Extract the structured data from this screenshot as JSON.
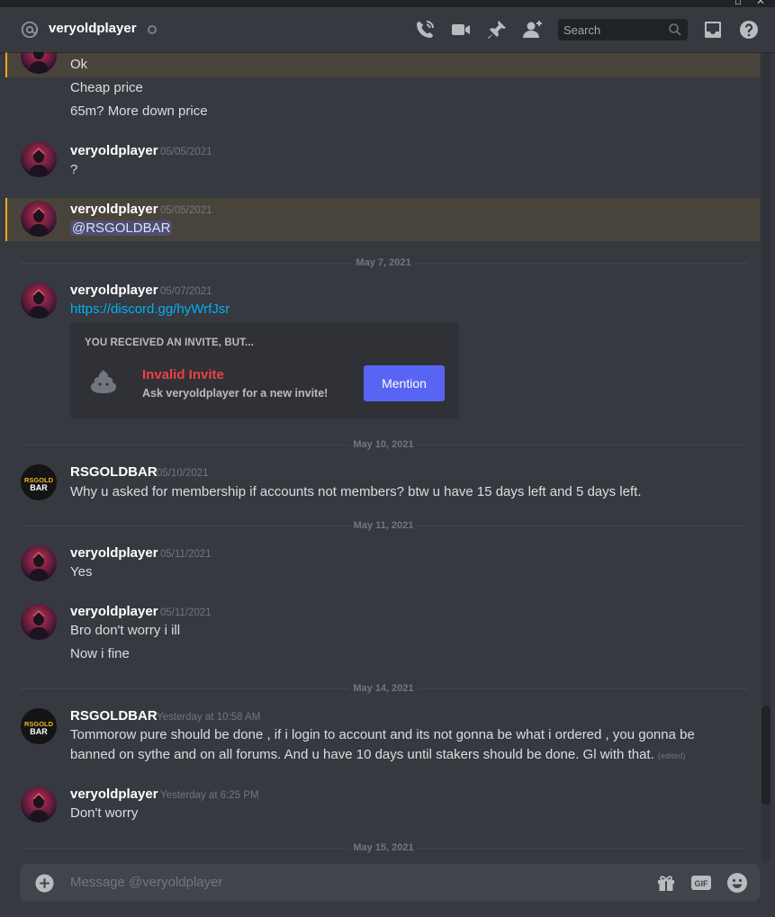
{
  "window": {
    "maximize_glyph": "▫",
    "close_glyph": "✕"
  },
  "header": {
    "username": "veryoldplayer",
    "search_placeholder": "Search",
    "icons": [
      "at-icon",
      "call-icon",
      "video-icon",
      "pin-icon",
      "add-user-icon",
      "search-icon",
      "inbox-icon",
      "help-icon"
    ]
  },
  "colors": {
    "background": "#36393f",
    "highlight_border": "#faa81a",
    "link": "#00aff4",
    "invalid": "#ed4245",
    "button": "#5865f2"
  },
  "messages": {
    "m0": {
      "lines": [
        "Ok",
        "Cheap price",
        "65m? More down price"
      ]
    },
    "m1": {
      "author": "veryoldplayer",
      "timestamp": "05/05/2021",
      "text": "?"
    },
    "m2": {
      "author": "veryoldplayer",
      "timestamp": "05/05/2021",
      "mention": "@RSGOLDBAR"
    },
    "d1": "May 7, 2021",
    "m3": {
      "author": "veryoldplayer",
      "timestamp": "05/07/2021",
      "link": "https://discord.gg/hyWrfJsr",
      "invite": {
        "heading": "YOU RECEIVED AN INVITE, BUT...",
        "title": "Invalid Invite",
        "subtitle": "Ask veryoldplayer for a new invite!",
        "button": "Mention"
      }
    },
    "d2": "May 10, 2021",
    "m4": {
      "author": "RSGOLDBAR",
      "timestamp": "05/10/2021",
      "text": "Why u asked for membership if accounts not members? btw u have 15 days left and 5 days left."
    },
    "d3": "May 11, 2021",
    "m5": {
      "author": "veryoldplayer",
      "timestamp": "05/11/2021",
      "text": "Yes"
    },
    "m6": {
      "author": "veryoldplayer",
      "timestamp": "05/11/2021",
      "lines": [
        "Bro don't worry i ill",
        "Now i fine"
      ]
    },
    "d4": "May 14, 2021",
    "m7": {
      "author": "RSGOLDBAR",
      "timestamp": "Yesterday at 10:58 AM",
      "text": "Tommorow pure should be done , if i login to account and its not gonna be what i ordered , you gonna be banned on sythe and on all forums. And u have 10 days until stakers should be done. Gl with that.",
      "edited": "(edited)"
    },
    "m8": {
      "author": "veryoldplayer",
      "timestamp": "Yesterday at 6:25 PM",
      "text": "Don't worry"
    },
    "d5": "May 15, 2021"
  },
  "avatar_logo": {
    "line1": "RSGOLD",
    "line2": "BAR"
  },
  "composer": {
    "placeholder": "Message @veryoldplayer",
    "gif_label": "GIF"
  }
}
